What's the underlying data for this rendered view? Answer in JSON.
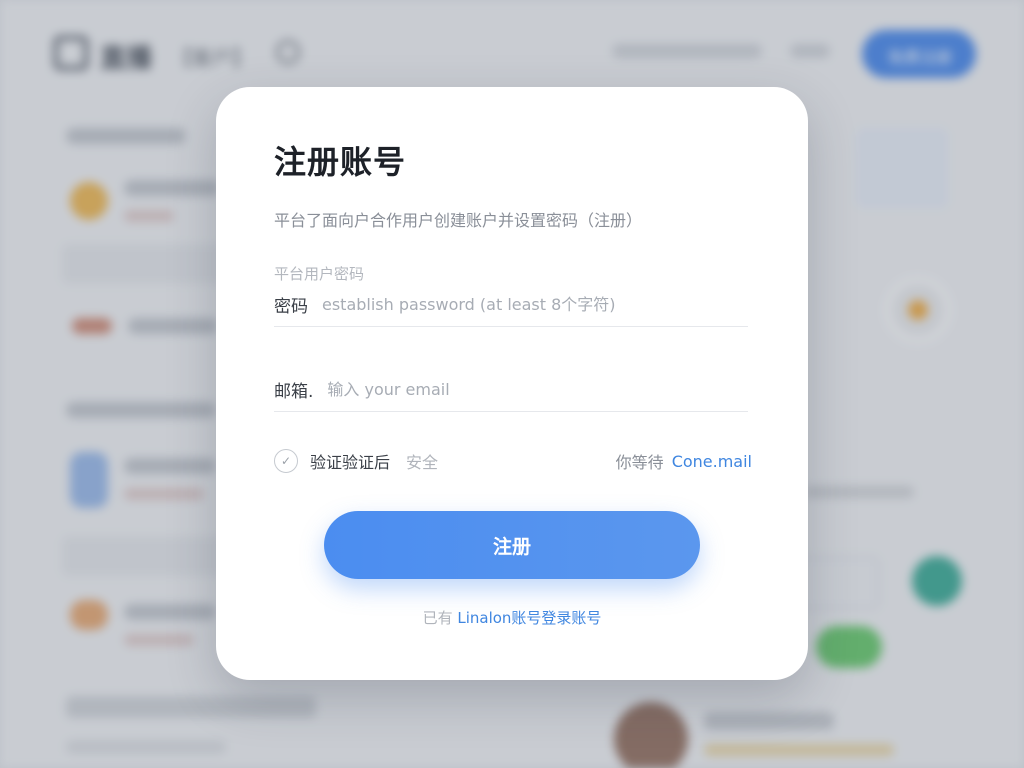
{
  "background": {
    "brand": "直播",
    "nav_label": "【客户】",
    "top_button": "免费注册"
  },
  "modal": {
    "title": "注册账号",
    "description": "平台了面向户合作用户创建账户并设置密码（注册）",
    "password_hint": "平台用户密码",
    "password_label": "密码",
    "password_placeholder": "establish password (at least 8个字符)",
    "email_label": "邮箱.",
    "email_placeholder": "输入 your email",
    "verify_label": "验证验证后",
    "verify_hint": "安全",
    "wait_text": "你等待",
    "email_link": "Cone.mail",
    "submit_label": "注册",
    "footer_prefix": "已有",
    "footer_link": "Linalon账号登录账号"
  },
  "colors": {
    "accent": "#4b8df0",
    "link": "#3f86e0",
    "title": "#1d2128"
  }
}
